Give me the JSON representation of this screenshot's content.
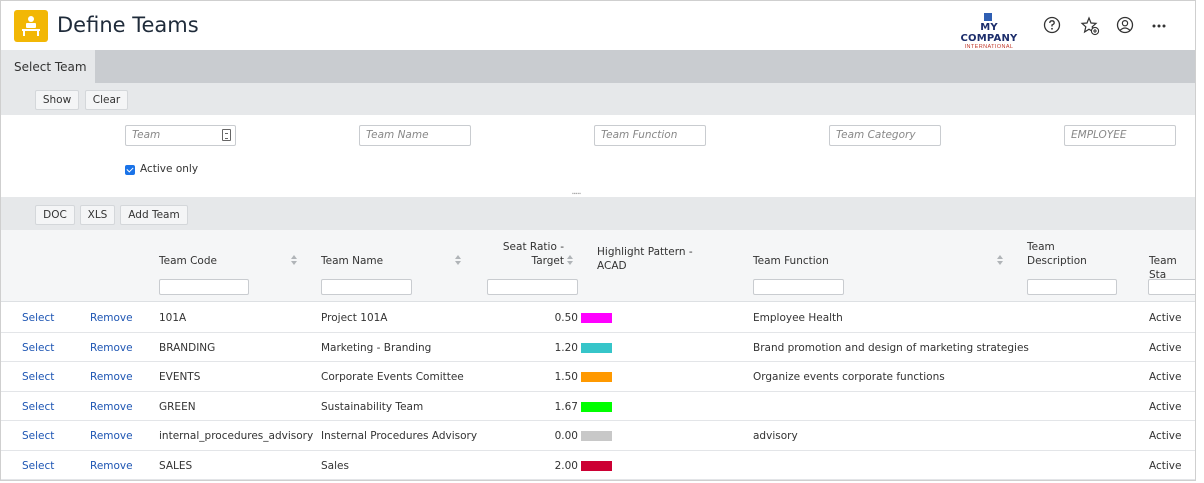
{
  "header": {
    "title": "Define Teams",
    "logo_main": "MY COMPANY",
    "logo_sub": "INTERNATIONAL",
    "icons": [
      "help-icon",
      "favorite-add-icon",
      "user-account-icon",
      "more-icon"
    ]
  },
  "tabs": [
    {
      "label": "Select Team"
    }
  ],
  "filter_toolbar": {
    "show": "Show",
    "clear": "Clear"
  },
  "filters": {
    "team": "Team",
    "team_name": "Team Name",
    "team_function": "Team Function",
    "team_category": "Team Category",
    "employee": "EMPLOYEE",
    "active_only": "Active only"
  },
  "grid_toolbar": {
    "doc": "DOC",
    "xls": "XLS",
    "add_team": "Add Team"
  },
  "columns": {
    "team_code": "Team Code",
    "team_name": "Team Name",
    "seat_ratio_1": "Seat Ratio -",
    "seat_ratio_2": "Target",
    "highlight_1": "Highlight Pattern -",
    "highlight_2": "ACAD",
    "team_function": "Team Function",
    "team_desc_1": "Team",
    "team_desc_2": "Description",
    "team_status": "Team Sta"
  },
  "row_actions": {
    "select": "Select",
    "remove": "Remove"
  },
  "rows": [
    {
      "code": "101A",
      "name": "Project 101A",
      "ratio": "0.50",
      "color": "#ff00ff",
      "function": "Employee Health",
      "status": "Active"
    },
    {
      "code": "BRANDING",
      "name": "Marketing - Branding",
      "ratio": "1.20",
      "color": "#36c5c9",
      "function": "Brand promotion and design of marketing strategies",
      "status": "Active"
    },
    {
      "code": "EVENTS",
      "name": "Corporate Events Comittee",
      "ratio": "1.50",
      "color": "#ff9900",
      "function": "Organize events corporate functions",
      "status": "Active"
    },
    {
      "code": "GREEN",
      "name": "Sustainability Team",
      "ratio": "1.67",
      "color": "#00ff00",
      "function": "",
      "status": "Active"
    },
    {
      "code": "internal_procedures_advisory",
      "name": "Insternal Procedures Advisory",
      "ratio": "0.00",
      "color": "#c8c8c8",
      "function": "advisory",
      "status": "Active"
    },
    {
      "code": "SALES",
      "name": "Sales",
      "ratio": "2.00",
      "color": "#cc0033",
      "function": "",
      "status": "Active"
    }
  ],
  "colors": {
    "accent": "#f2b705",
    "link": "#1d55b3",
    "checkbox": "#1a73e8"
  }
}
